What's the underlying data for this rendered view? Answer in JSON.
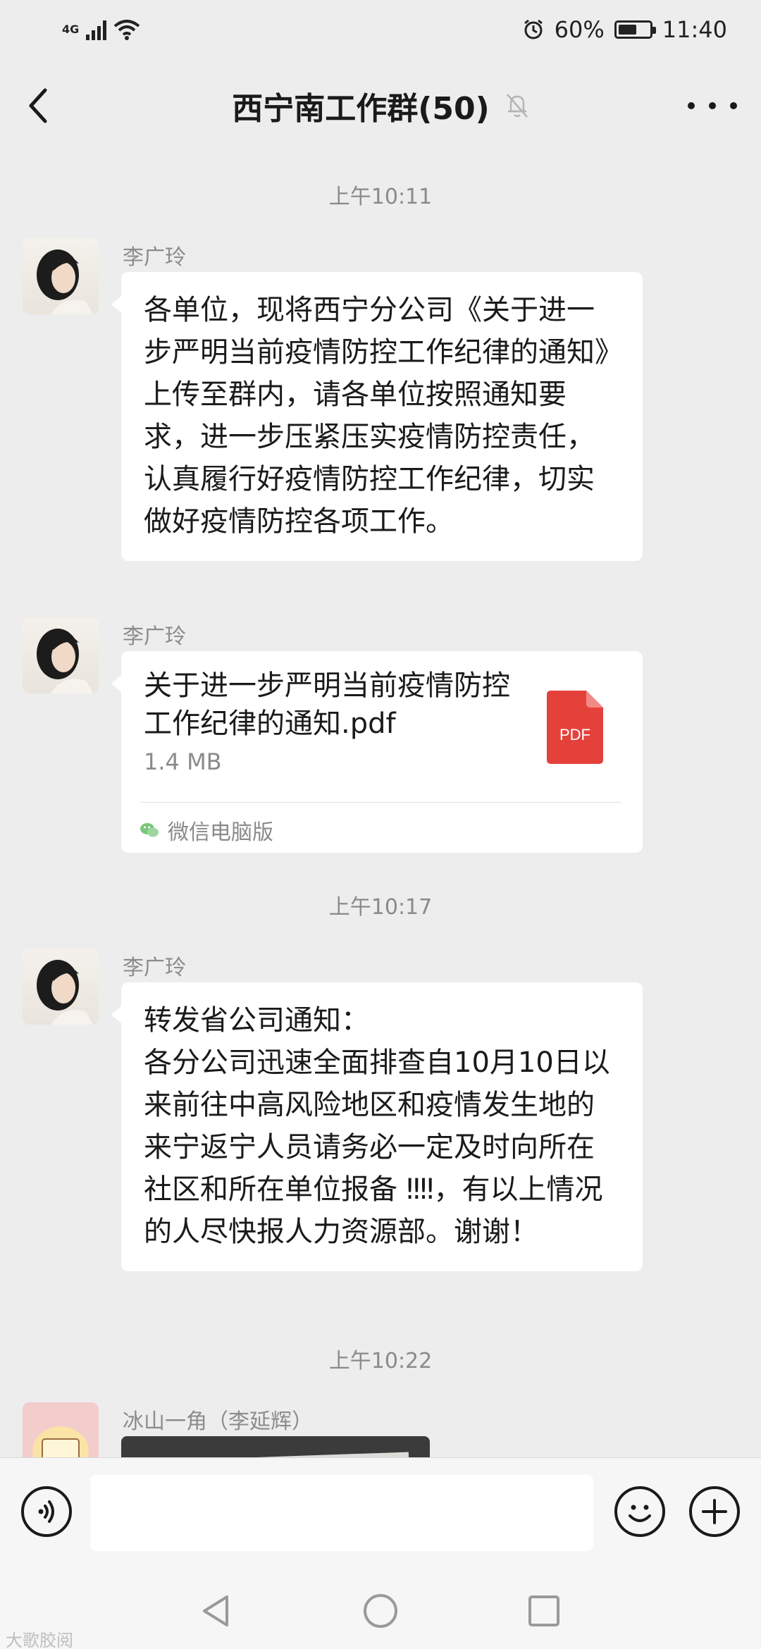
{
  "status_bar": {
    "network": "4G",
    "battery_percent": "60%",
    "time": "11:40",
    "icons": [
      "signal-icon",
      "wifi-icon",
      "alarm-icon",
      "battery-icon"
    ]
  },
  "header": {
    "title": "西宁南工作群(50)",
    "back_icon": "chevron-left-icon",
    "mute_icon": "bell-off-icon",
    "more_icon": "more-dots-icon"
  },
  "chat": {
    "timestamps": [
      "上午10:11",
      "上午10:17",
      "上午10:22"
    ],
    "messages": [
      {
        "sender": "李广玲",
        "type": "text",
        "text": "各单位，现将西宁分公司《关于进一步严明当前疫情防控工作纪律的通知》上传至群内，请各单位按照通知要求，进一步压紧压实疫情防控责任，认真履行好疫情防控工作纪律，切实做好疫情防控各项工作。"
      },
      {
        "sender": "李广玲",
        "type": "file",
        "file_name": "关于进一步严明当前疫情防控工作纪律的通知.pdf",
        "file_size": "1.4 MB",
        "file_badge": "PDF",
        "source": "微信电脑版"
      },
      {
        "sender": "李广玲",
        "type": "text",
        "text": "转发省公司通知：\n各分公司迅速全面排查自10月10日以来前往中高风险地区和疫情发生地的来宁返宁人员请务必一定及时向所在社区和所在单位报备 ‼‼，有以上情况的人尽快报人力资源部。谢谢！"
      },
      {
        "sender": "冰山一角（李延辉）",
        "type": "image"
      }
    ]
  },
  "input_bar": {
    "placeholder": "",
    "voice_icon": "voice-icon",
    "emoji_icon": "emoji-icon",
    "plus_icon": "plus-icon"
  },
  "system_nav": {
    "icons": [
      "back-triangle-icon",
      "home-circle-icon",
      "recents-square-icon"
    ]
  },
  "watermark": "大歌胶阅"
}
